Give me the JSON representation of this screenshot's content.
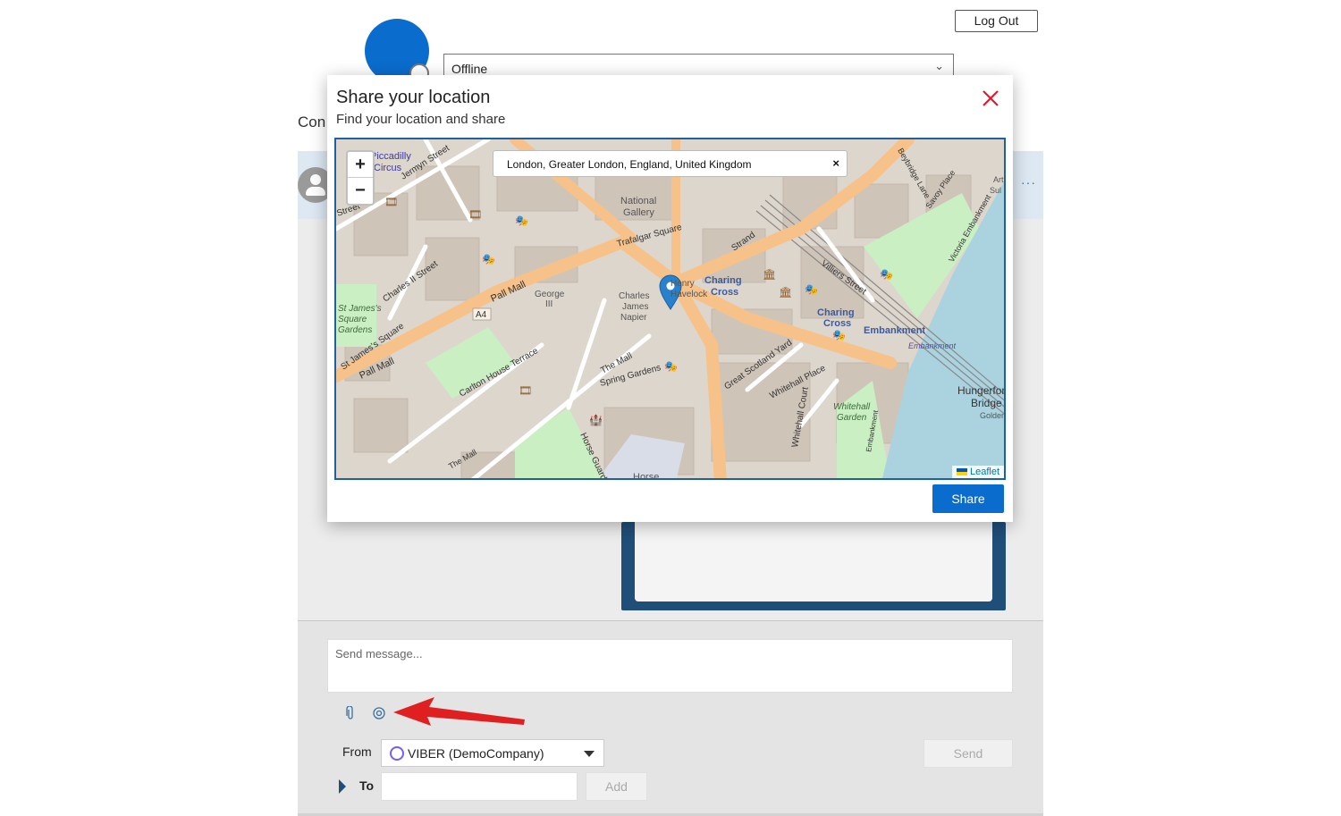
{
  "header": {
    "logout_label": "Log Out",
    "status_value": "Offline"
  },
  "conversation": {
    "label_fragment": "Con",
    "more_icon": "ellipsis-icon"
  },
  "compose": {
    "message_placeholder": "Send message...",
    "icons": [
      "paperclip-icon",
      "location-target-icon"
    ],
    "from_label": "From",
    "from_value": "VIBER (DemoCompany)",
    "send_label": "Send",
    "to_label": "To",
    "add_label": "Add"
  },
  "modal": {
    "title": "Share your location",
    "subtitle": "Find your location and share",
    "close_icon": "close-icon",
    "share_label": "Share",
    "map": {
      "search_value": "London, Greater London, England, United Kingdom",
      "search_clear": "×",
      "zoom_in": "+",
      "zoom_out": "−",
      "attribution": "Leaflet",
      "labels": {
        "piccadilly": "Piccadilly",
        "circus": "Circus",
        "jermyn": "Jermyn Street",
        "street": "Street",
        "national": "National",
        "gallery": "Gallery",
        "trafalgar": "Trafalgar Square",
        "pall_mall_1": "Pall Mall",
        "pall_mall_2": "Pall Mall",
        "charles_ii": "Charles II Street",
        "st_james_1": "St James's",
        "st_james_2": "Square",
        "st_james_3": "Gardens",
        "st_james_sq": "St James's Square",
        "a4": "A4",
        "george_1": "George",
        "george_2": "III",
        "charles_1": "Charles",
        "charles_2": "James",
        "charles_3": "Napier",
        "henry_1": "Henry",
        "henry_2": "Havelock",
        "charing_1": "Charing",
        "charing_2": "Cross",
        "charing_3": "Charing",
        "charing_4": "Cross",
        "strand": "Strand",
        "villiers": "Villiers Street",
        "embankment_1": "Embankment",
        "embankment_2": "Embankment",
        "embankment_3": "Embankment",
        "carlton": "Carlton House Terrace",
        "the_mall_1": "The Mall",
        "the_mall_2": "The Mall",
        "spring": "Spring Gardens",
        "great_scotland": "Great Scotland Yard",
        "whitehall_place": "Whitehall Place",
        "whitehall_court": "Whitehall Court",
        "whitehall_1": "Whitehall",
        "whitehall_2": "Garden",
        "horse_guards": "Horse Guards",
        "horse": "Horse",
        "hungerford_1": "Hungerford",
        "hungerford_2": "Bridge",
        "golden": "Golden",
        "victoria_emb": "Victoria Embankment",
        "savoy": "Savoy Place",
        "york": "Beybridge Lane",
        "arts_1": "Art",
        "arts_2": "Sul"
      }
    }
  },
  "colors": {
    "accent": "#0a6ccc",
    "close_red": "#e81123",
    "frame_navy": "#1f4e79",
    "arrow_red": "#e02020"
  }
}
